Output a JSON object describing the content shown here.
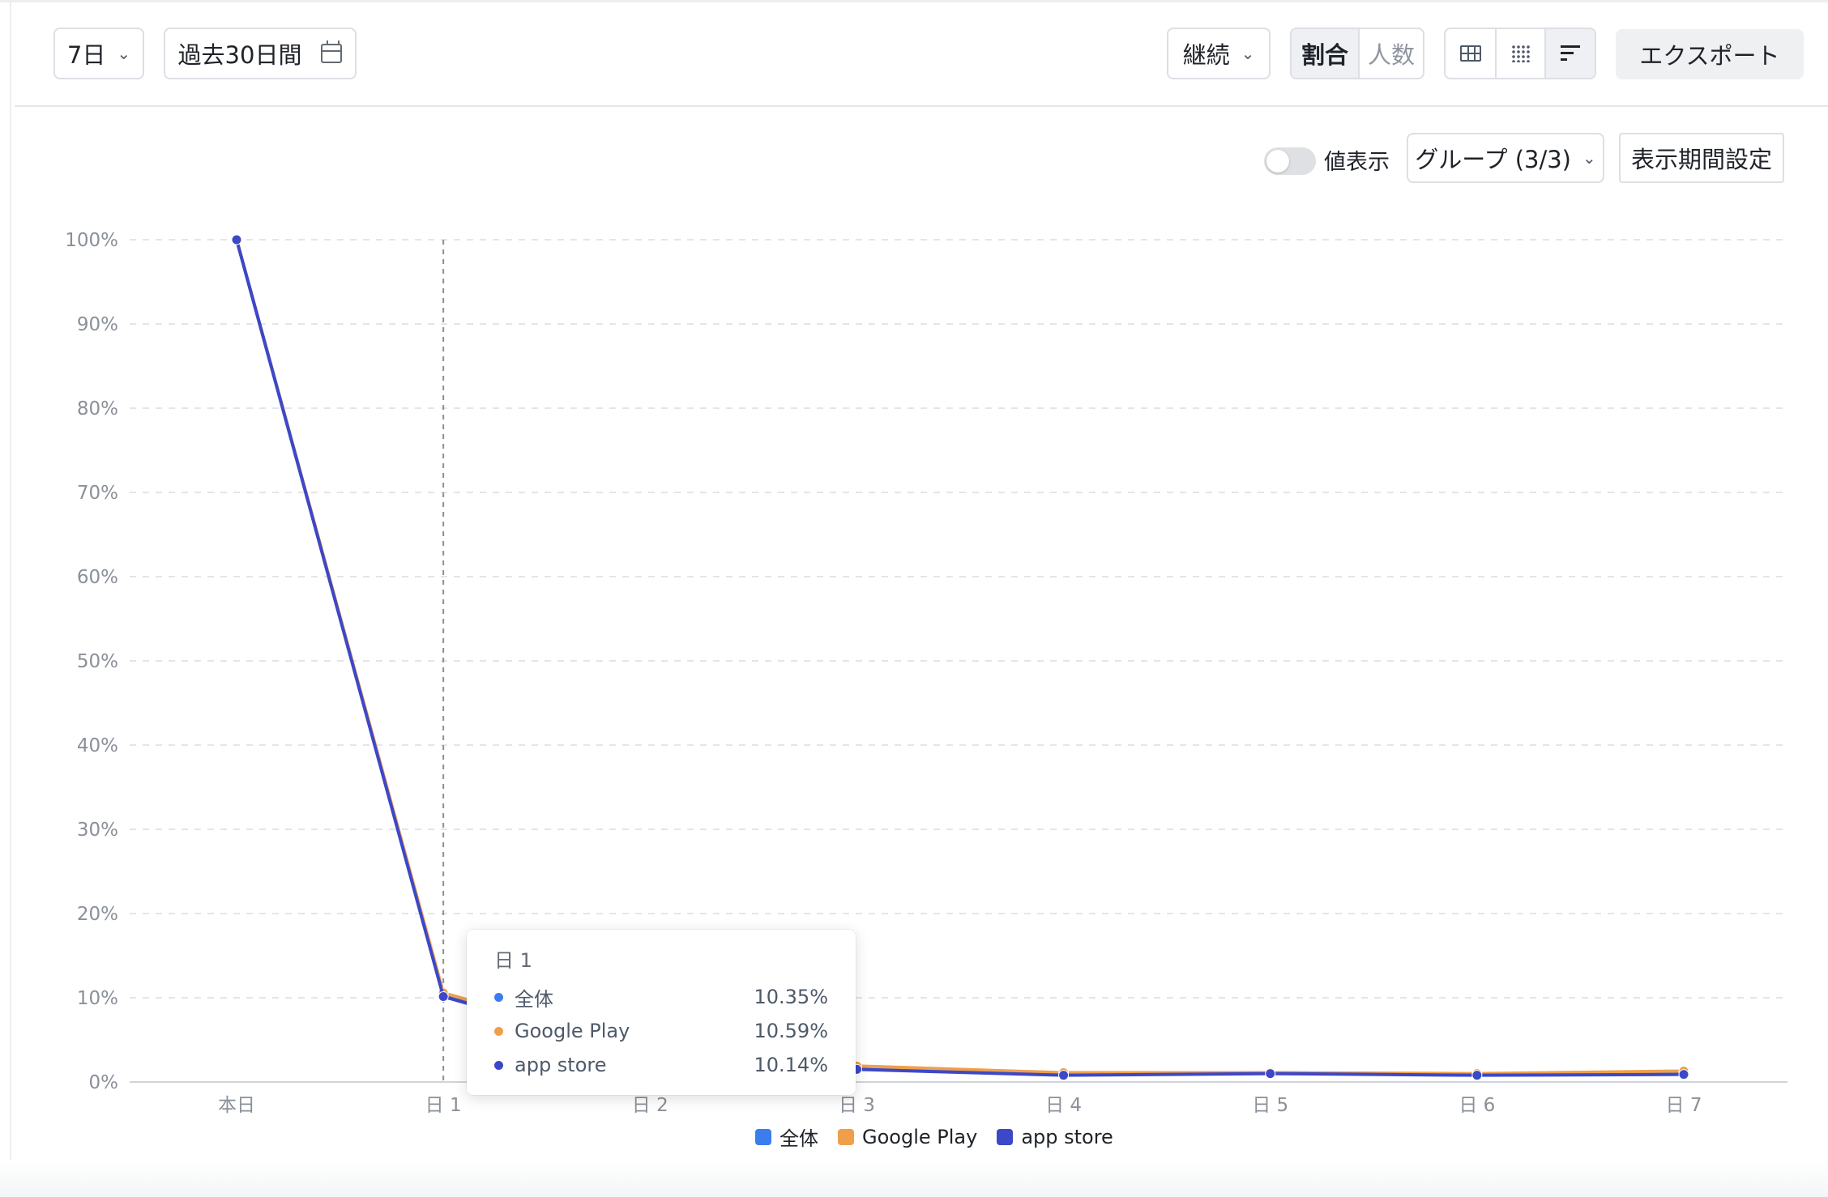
{
  "toolbar": {
    "period_select": "7日",
    "date_range": "過去30日間",
    "metric_select": "継続",
    "mode_options": [
      "割合",
      "人数"
    ],
    "active_mode": "割合",
    "export_label": "エクスポート"
  },
  "chart_controls": {
    "value_display_label": "値表示",
    "value_display_on": false,
    "group_select": "グループ (3/3)",
    "period_setting_label": "表示期間設定"
  },
  "colors": {
    "overall": "#3b7ded",
    "google_play": "#ef9f4b",
    "app_store": "#3c48c8"
  },
  "chart_data": {
    "type": "line",
    "categories": [
      "本日",
      "日 1",
      "日 2",
      "日 3",
      "日 4",
      "日 5",
      "日 6",
      "日 7"
    ],
    "ylim": [
      0,
      100
    ],
    "yticks": [
      "0%",
      "10%",
      "20%",
      "30%",
      "40%",
      "50%",
      "60%",
      "70%",
      "80%",
      "90%",
      "100%"
    ],
    "grid": true,
    "legend": "bottom-center",
    "series": [
      {
        "name": "全体",
        "values": [
          100,
          10.35,
          3.4,
          1.7,
          1.0,
          1.1,
          0.9,
          1.1
        ]
      },
      {
        "name": "Google Play",
        "values": [
          100,
          10.59,
          3.6,
          1.9,
          1.1,
          1.1,
          1.0,
          1.3
        ]
      },
      {
        "name": "app store",
        "values": [
          100,
          10.14,
          3.2,
          1.5,
          0.8,
          1.0,
          0.8,
          0.9
        ]
      }
    ],
    "hover_index": 1
  },
  "tooltip": {
    "title": "日 1",
    "rows": [
      {
        "name": "全体",
        "value": "10.35%"
      },
      {
        "name": "Google Play",
        "value": "10.59%"
      },
      {
        "name": "app store",
        "value": "10.14%"
      }
    ]
  }
}
